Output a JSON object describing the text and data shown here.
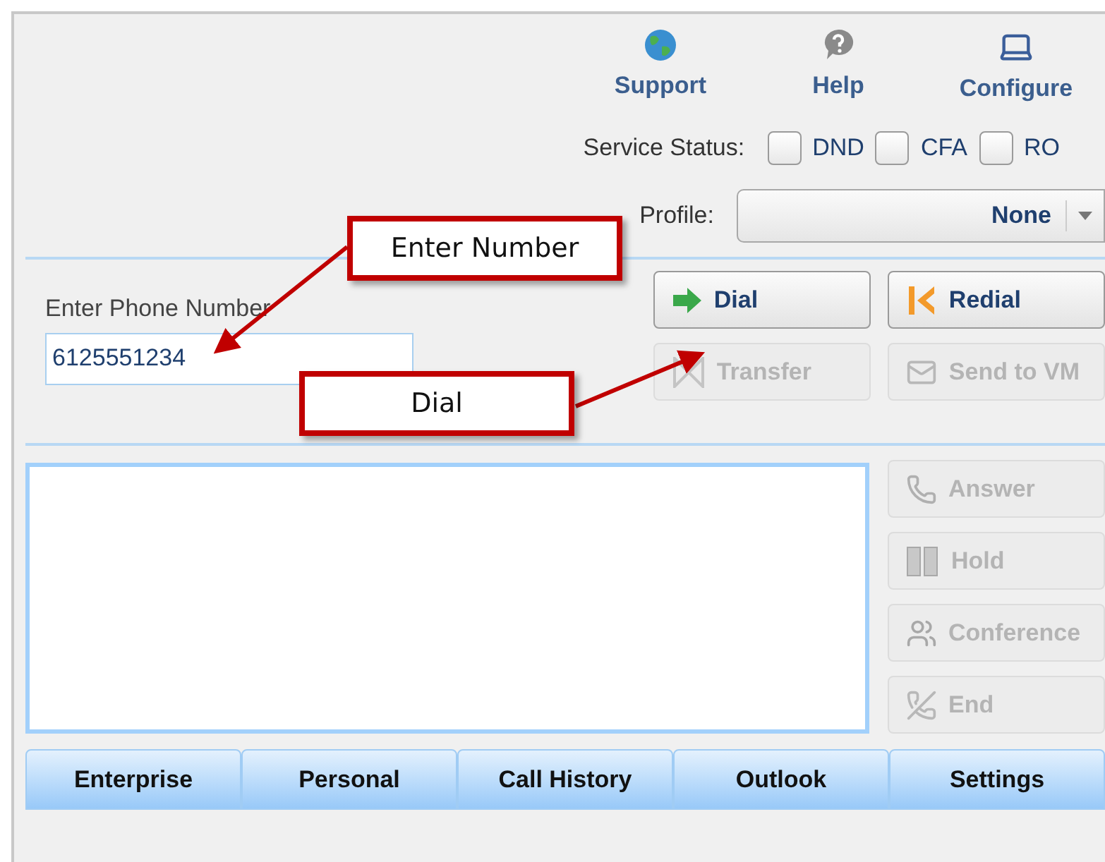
{
  "toolbar": [
    {
      "label": "Support",
      "kind": "globe"
    },
    {
      "label": "Help",
      "kind": "help"
    },
    {
      "label": "Configure",
      "kind": "computer"
    }
  ],
  "service_status": {
    "label": "Service Status:",
    "options": [
      {
        "label": "DND",
        "checked": false
      },
      {
        "label": "CFA",
        "checked": false
      },
      {
        "label": "RO",
        "checked": false
      }
    ]
  },
  "profile": {
    "label": "Profile:",
    "value": "None"
  },
  "phone_field": {
    "label": "Enter Phone Number",
    "value": "6125551234"
  },
  "call_buttons": [
    {
      "label": "Dial",
      "kind": "dial",
      "disabled": false
    },
    {
      "label": "Redial",
      "kind": "redial",
      "disabled": false
    },
    {
      "label": "Transfer",
      "kind": "transfer",
      "disabled": true
    },
    {
      "label": "Send to VM",
      "kind": "voicemail",
      "disabled": true
    }
  ],
  "side_buttons": [
    {
      "label": "Answer",
      "kind": "answer",
      "disabled": true
    },
    {
      "label": "Hold",
      "kind": "hold",
      "disabled": true
    },
    {
      "label": "Conference",
      "kind": "conference",
      "disabled": true
    },
    {
      "label": "End",
      "kind": "end",
      "disabled": true
    }
  ],
  "tabs": [
    {
      "label": "Enterprise"
    },
    {
      "label": "Personal"
    },
    {
      "label": "Call History"
    },
    {
      "label": "Outlook"
    },
    {
      "label": "Settings"
    }
  ],
  "callouts": [
    {
      "text": "Enter Number"
    },
    {
      "text": "Dial"
    }
  ]
}
